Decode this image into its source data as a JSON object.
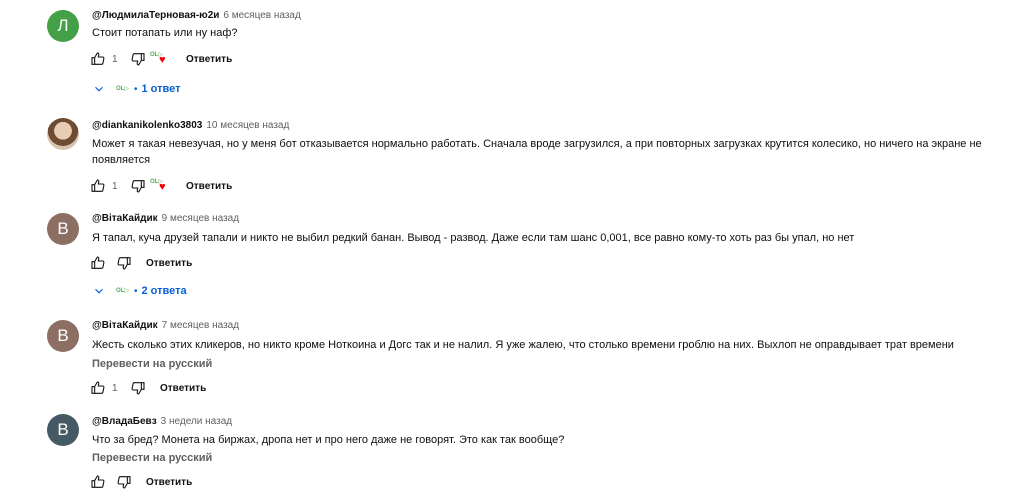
{
  "colors": {
    "link": "#065fd4",
    "muted": "#606060",
    "heart": "#ee0000"
  },
  "comments": [
    {
      "avatar_letter": "Л",
      "avatar_color": "#43a047",
      "author": "@ЛюдмилаТерновая-ю2и",
      "time": "6 месяцев назад",
      "text": "Стоит потапать или ну наф?",
      "likes": "1",
      "reply_label": "Ответить",
      "replies_label": "1 ответ",
      "creator_heart": true
    },
    {
      "avatar_letter": "",
      "avatar_color": "#d8c3ad",
      "author": "@diankanikolenko3803",
      "time": "10 месяцев назад",
      "text": "Может я такая невезучая, но у меня бот отказывается нормально работать. Сначала вроде загрузился, а при повторных загрузках крутится колесико, но ничего на экране не появляется",
      "likes": "1",
      "reply_label": "Ответить",
      "creator_heart": true
    },
    {
      "avatar_letter": "В",
      "avatar_color": "#8d6e63",
      "author": "@ВітаКайдик",
      "time": "9 месяцев назад",
      "text": "Я тапал, куча друзей тапали и никто не выбил редкий банан. Вывод - развод. Даже если там шанс 0,001, все равно кому-то хоть раз бы упал, но нет",
      "likes": "",
      "reply_label": "Ответить",
      "replies_label": "2 ответа"
    },
    {
      "avatar_letter": "В",
      "avatar_color": "#8d6e63",
      "author": "@ВітаКайдик",
      "time": "7 месяцев назад",
      "text": "Жесть сколько этих кликеров, но никто кроме Ноткоина и Догс так и не налил. Я уже жалею, что столько времени гроблю на них. Выхлоп не оправдывает трат времени",
      "translate_label": "Перевести на русский",
      "likes": "1",
      "reply_label": "Ответить"
    },
    {
      "avatar_letter": "В",
      "avatar_color": "#455a64",
      "author": "@ВладаБевз",
      "time": "3 недели назад",
      "text": "Что за бред? Монета на биржах, дропа нет и про него даже не говорят. Это как так вообще?",
      "translate_label": "Перевести на русский",
      "likes": "",
      "reply_label": "Ответить"
    }
  ]
}
